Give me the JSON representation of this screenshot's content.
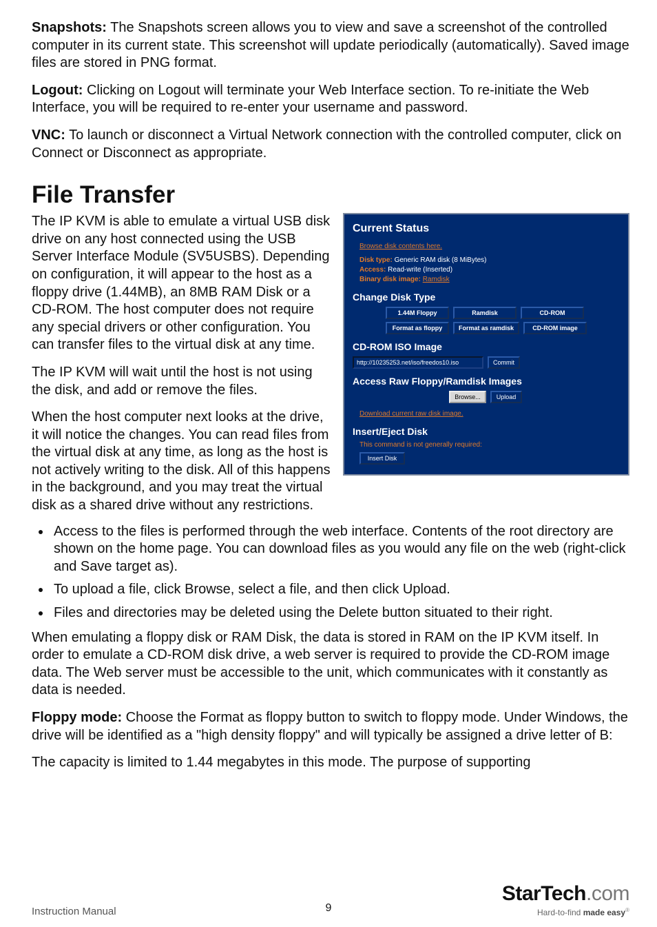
{
  "paragraphs": {
    "p1_strong": "Snapshots:",
    "p1": " The Snapshots screen allows you to view and save a screenshot of the controlled computer in its current state. This screenshot will update periodically (automatically). Saved image files are stored in PNG format.",
    "p2_strong": "Logout:",
    "p2": " Clicking on Logout will terminate your Web Interface section. To re-initiate the Web Interface, you will be required to re-enter your username and password.",
    "p3_strong": "VNC:",
    "p3": " To launch or disconnect a Virtual Network connection with the controlled computer, click on Connect or Disconnect as appropriate."
  },
  "section_title": "File Transfer",
  "left": {
    "p1": "The IP KVM is able to emulate a virtual USB disk drive on any host connected using the USB Server Interface Module (SV5USBS). Depending on configuration, it will appear to the host as a floppy drive (1.44MB), an 8MB RAM Disk or a CD-ROM. The host computer does not require any special drivers or other configuration. You can transfer files to the virtual disk at any time.",
    "p2": "The IP KVM will wait until the host is not using the disk, and add or remove the files.",
    "p3": "When the host computer next looks at the drive, it will notice the changes. You can read files from the virtual disk at any time, as long as the host is not actively writing to the disk. All of this happens in the background, and you may treat the virtual disk as a shared drive without any restrictions."
  },
  "bullets": {
    "b1": "Access to the files is performed through the web interface. Contents of the root directory are shown on the home page. You can download files as you would any file on the web (right-click and Save target as).",
    "b2": "To upload a file, click Browse, select a file, and then click Upload.",
    "b3": "Files and directories may be deleted using the Delete button situated to their right."
  },
  "after": {
    "p1": "When emulating a floppy disk or RAM Disk, the data is stored in RAM on the IP KVM itself. In order to emulate a CD-ROM disk drive, a web server is required to provide the CD-ROM image data. The Web server must be accessible to the unit, which communicates with it constantly as data is needed.",
    "p2_strong": "Floppy mode:",
    "p2": " Choose the Format as floppy button to switch to floppy mode. Under Windows, the drive will be identified as a \"high density floppy\" and will typically be assigned a drive letter of B:",
    "p3": "The capacity is limited to 1.44 megabytes in this mode. The purpose of supporting"
  },
  "screenshot": {
    "h_current": "Current Status",
    "browse_link": "Browse disk contents here.",
    "disk_type_k": "Disk type:",
    "disk_type_v": " Generic RAM disk (8 MiBytes)",
    "access_k": "Access:",
    "access_v": " Read-write (Inserted)",
    "binary_k": "Binary disk image:",
    "binary_link": "Ramdisk",
    "h_change": "Change Disk Type",
    "btn_144": "1.44M Floppy",
    "btn_ram": "Ramdisk",
    "btn_cdrom": "CD-ROM",
    "btn_ffloppy": "Format as floppy",
    "btn_framdisk": "Format as ramdisk",
    "btn_cdimage": "CD-ROM image",
    "h_cdrom": "CD-ROM ISO Image",
    "iso_url": "http://10235253.net/iso/freedos10.iso",
    "btn_commit": "Commit",
    "h_access": "Access Raw Floppy/Ramdisk Images",
    "btn_browse": "Browse...",
    "btn_upload": "Upload",
    "download_link": "Download current raw disk image.",
    "h_insert": "Insert/Eject Disk",
    "note": "This command is not generally required:",
    "btn_insert": "Insert Disk"
  },
  "footer": {
    "instruction": "Instruction Manual",
    "page": "9",
    "brand_bold": "StarTech",
    "brand_com": ".com",
    "tag1": "Hard-to-find ",
    "tag2": "made easy"
  }
}
